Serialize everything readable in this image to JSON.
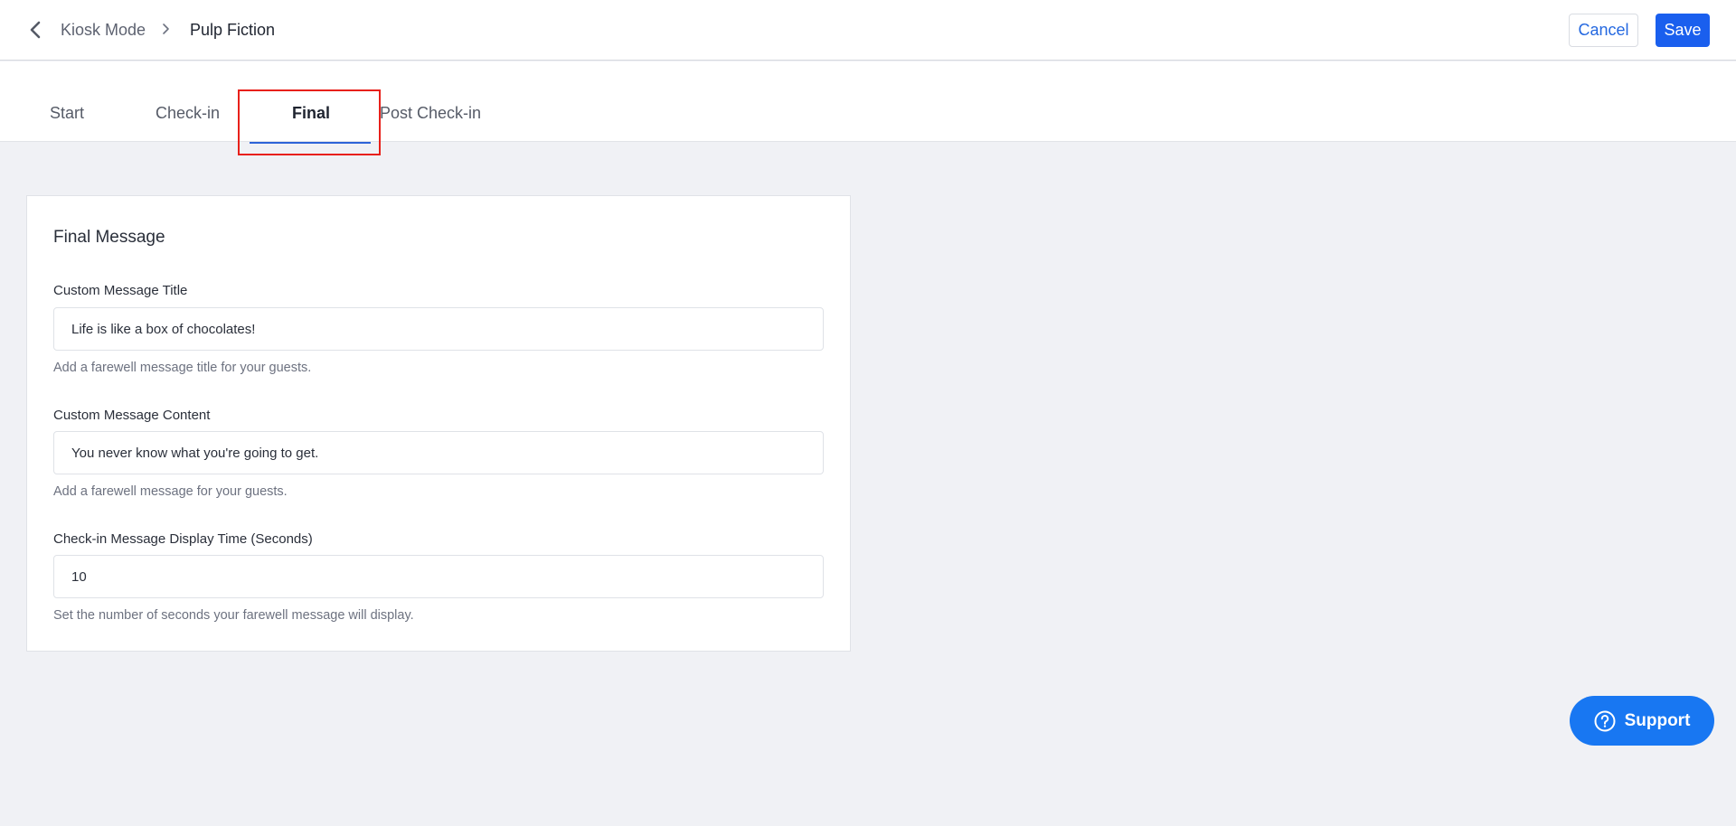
{
  "breadcrumb": {
    "parent": "Kiosk Mode",
    "current": "Pulp Fiction"
  },
  "toolbar": {
    "cancel_label": "Cancel",
    "save_label": "Save"
  },
  "tabs": [
    {
      "label": "Start",
      "active": false
    },
    {
      "label": "Check-in",
      "active": false
    },
    {
      "label": "Final",
      "active": true
    },
    {
      "label": "Post Check-in",
      "active": false
    }
  ],
  "final_message": {
    "title": "Final Message",
    "fields": [
      {
        "label": "Custom Message Title",
        "value": "Life is like a box of chocolates!",
        "help": "Add a farewell message title for your guests."
      },
      {
        "label": "Custom Message Content",
        "value": "You never know what you're going to get.",
        "help": "Add a farewell message for your guests."
      },
      {
        "label": "Check-in Message Display Time (Seconds)",
        "value": "10",
        "help": "Set the number of seconds your farewell message will display."
      }
    ]
  },
  "support": {
    "label": "Support"
  },
  "colors": {
    "accent": "#1a5fee",
    "support": "#1877f2",
    "highlight": "#e8201a"
  }
}
